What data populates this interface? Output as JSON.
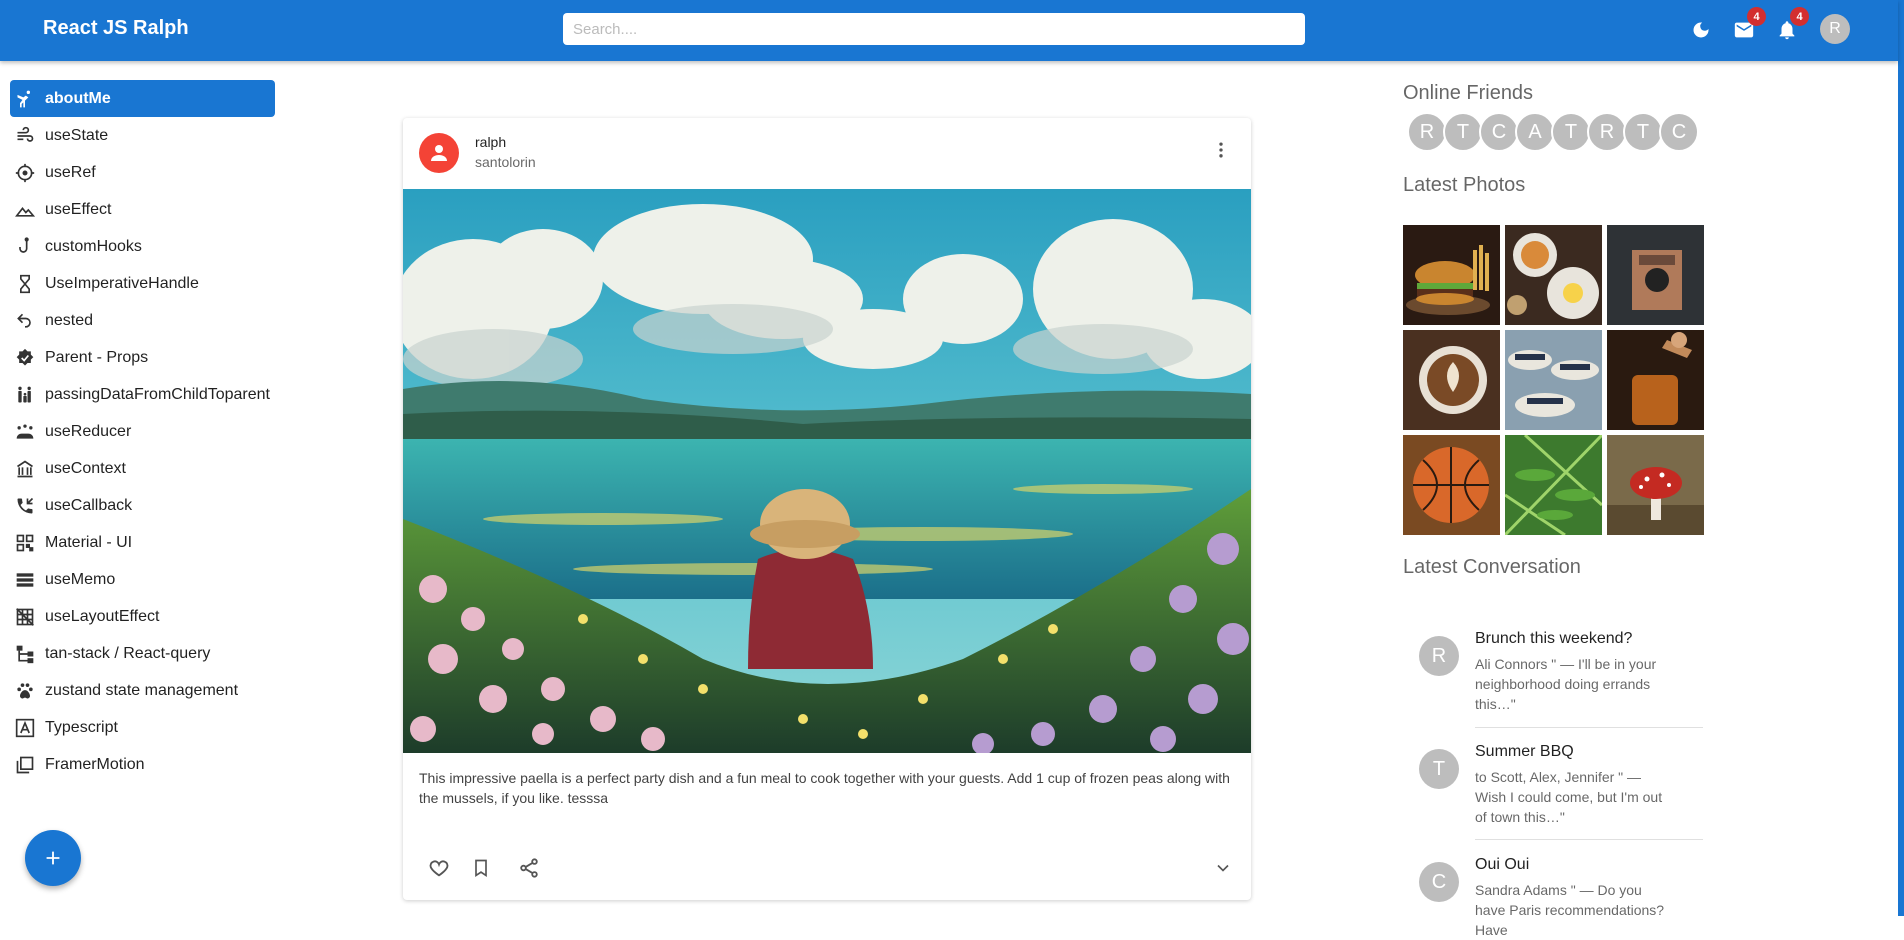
{
  "app": {
    "title": "React JS Ralph"
  },
  "search": {
    "placeholder": "Search...."
  },
  "header": {
    "mail_badge": "4",
    "notifications_badge": "4",
    "user_initial": "R"
  },
  "sidebar": {
    "items": [
      {
        "label": "aboutMe",
        "icon": "karate-icon"
      },
      {
        "label": "useState",
        "icon": "wind-icon"
      },
      {
        "label": "useRef",
        "icon": "target-icon"
      },
      {
        "label": "useEffect",
        "icon": "landscape-icon"
      },
      {
        "label": "customHooks",
        "icon": "hook-icon"
      },
      {
        "label": "UseImperativeHandle",
        "icon": "hourglass-icon"
      },
      {
        "label": "nested",
        "icon": "undo-icon"
      },
      {
        "label": "Parent - Props",
        "icon": "badge-check-icon"
      },
      {
        "label": "passingDataFromChildToparent",
        "icon": "family-icon"
      },
      {
        "label": "useReducer",
        "icon": "groups-icon"
      },
      {
        "label": "useContext",
        "icon": "museum-icon"
      },
      {
        "label": "useCallback",
        "icon": "phone-callback-icon"
      },
      {
        "label": "Material - UI",
        "icon": "qr-code-icon"
      },
      {
        "label": "useMemo",
        "icon": "storage-icon"
      },
      {
        "label": "useLayoutEffect",
        "icon": "grid-off-icon"
      },
      {
        "label": "tan-stack / React-query",
        "icon": "account-tree-icon"
      },
      {
        "label": "zustand state management",
        "icon": "paw-icon"
      },
      {
        "label": "Typescript",
        "icon": "font-box-icon"
      },
      {
        "label": "FramerMotion",
        "icon": "filter-none-icon"
      }
    ]
  },
  "post": {
    "username": "ralph",
    "subheader": "santolorin",
    "body": "This impressive paella is a perfect party dish and a fun meal to cook together with your guests. Add 1 cup of frozen peas along with the mussels, if you like. tesssa"
  },
  "right": {
    "online_title": "Online Friends",
    "friends": [
      "R",
      "T",
      "C",
      "A",
      "T",
      "R",
      "T",
      "C"
    ],
    "photos_title": "Latest Photos",
    "photos": [
      "burger",
      "breakfast",
      "camera",
      "coffee",
      "hats",
      "honey",
      "basketball",
      "fern",
      "mushroom"
    ],
    "conversation_title": "Latest Conversation",
    "conversations": [
      {
        "initial": "R",
        "title": "Brunch this weekend?",
        "text": "Ali Connors \" — I'll be in your neighborhood doing errands this…\""
      },
      {
        "initial": "T",
        "title": "Summer BBQ",
        "text": "to Scott, Alex, Jennifer \" — Wish I could come, but I'm out of town this…\""
      },
      {
        "initial": "C",
        "title": "Oui Oui",
        "text": "Sandra Adams \" — Do you have Paris recommendations? Have"
      }
    ]
  },
  "colors": {
    "primary": "#1976d2",
    "avatar_red": "#f44336",
    "badge_red": "#d32f2f"
  }
}
